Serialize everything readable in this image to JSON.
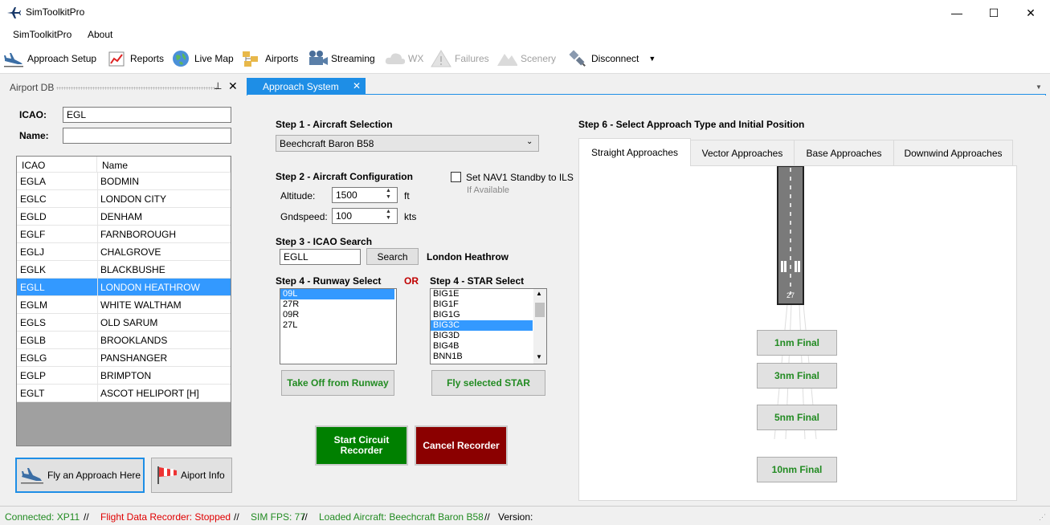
{
  "window": {
    "title": "SimToolkitPro",
    "minimize": "—",
    "maximize": "☐",
    "close": "✕"
  },
  "menu": {
    "items": [
      "SimToolkitPro",
      "About"
    ]
  },
  "toolbar": {
    "approach_setup": "Approach Setup",
    "reports": "Reports",
    "live_map": "Live Map",
    "airports": "Airports",
    "streaming": "Streaming",
    "wx": "WX",
    "failures": "Failures",
    "scenery": "Scenery",
    "disconnect": "Disconnect"
  },
  "airport_db": {
    "title": "Airport DB",
    "pin": "📌",
    "close": "✕",
    "icao_label": "ICAO:",
    "icao_value": "EGL",
    "name_label": "Name:",
    "name_value": "",
    "columns": [
      "ICAO",
      "Name"
    ],
    "rows": [
      [
        "EGLA",
        "BODMIN"
      ],
      [
        "EGLC",
        "LONDON CITY"
      ],
      [
        "EGLD",
        "DENHAM"
      ],
      [
        "EGLF",
        "FARNBOROUGH"
      ],
      [
        "EGLJ",
        "CHALGROVE"
      ],
      [
        "EGLK",
        "BLACKBUSHE"
      ],
      [
        "EGLL",
        "LONDON HEATHROW"
      ],
      [
        "EGLM",
        "WHITE WALTHAM"
      ],
      [
        "EGLS",
        "OLD SARUM"
      ],
      [
        "EGLB",
        "BROOKLANDS"
      ],
      [
        "EGLG",
        "PANSHANGER"
      ],
      [
        "EGLP",
        "BRIMPTON"
      ],
      [
        "EGLT",
        "ASCOT HELIPORT [H]"
      ]
    ],
    "selected_row": "EGLL",
    "fly_button": "Fly an Approach Here",
    "info_button": "Aiport Info"
  },
  "doc_tab": {
    "label": "Approach System",
    "close": "✕"
  },
  "approach": {
    "step1": "Step 1 - Aircraft Selection",
    "aircraft": "Beechcraft Baron B58",
    "step2": "Step 2 - Aircraft Configuration",
    "altitude_label": "Altitude:",
    "altitude_value": "1500",
    "altitude_unit": "ft",
    "gndspeed_label": "Gndspeed:",
    "gndspeed_value": "100",
    "gndspeed_unit": "kts",
    "nav1_label": "Set NAV1 Standby to ILS",
    "nav1_sub": "If Available",
    "step3": "Step 3 - ICAO Search",
    "icao_search_value": "EGLL",
    "search_button": "Search",
    "airport_name": "London Heathrow",
    "step4_runway": "Step 4 - Runway Select",
    "or": "OR",
    "step4_star": "Step 4 - STAR Select",
    "runways": [
      "09L",
      "27R",
      "09R",
      "27L"
    ],
    "selected_runway": "09L",
    "stars": [
      "BIG1E",
      "BIG1F",
      "BIG1G",
      "BIG3C",
      "BIG3D",
      "BIG4B",
      "BNN1B"
    ],
    "selected_star": "BIG3C",
    "takeoff_button": "Take Off from Runway",
    "fly_star_button": "Fly selected STAR",
    "start_circuit": "Start Circuit Recorder",
    "cancel_recorder": "Cancel Recorder",
    "step6": "Step 6 - Select Approach Type and Initial Position",
    "tabs": [
      "Straight Approaches",
      "Vector Approaches",
      "Base Approaches",
      "Downwind Approaches"
    ],
    "runway_number": "27",
    "finals": [
      "1nm Final",
      "3nm Final",
      "5nm Final",
      "10nm Final"
    ]
  },
  "status": {
    "connected": "Connected: XP11",
    "sep": "//",
    "recorder": "Flight Data Recorder: Stopped",
    "fps": "SIM FPS: 77",
    "aircraft": "Loaded Aircraft: Beechcraft Baron B58",
    "version": "Version:"
  },
  "colors": {
    "accent": "#1e8ee6",
    "selection": "#3399ff",
    "green_text": "#228b22",
    "start_green": "#008000",
    "cancel_red": "#8b0000",
    "status_red": "#e00000",
    "or_red": "#c00000"
  }
}
